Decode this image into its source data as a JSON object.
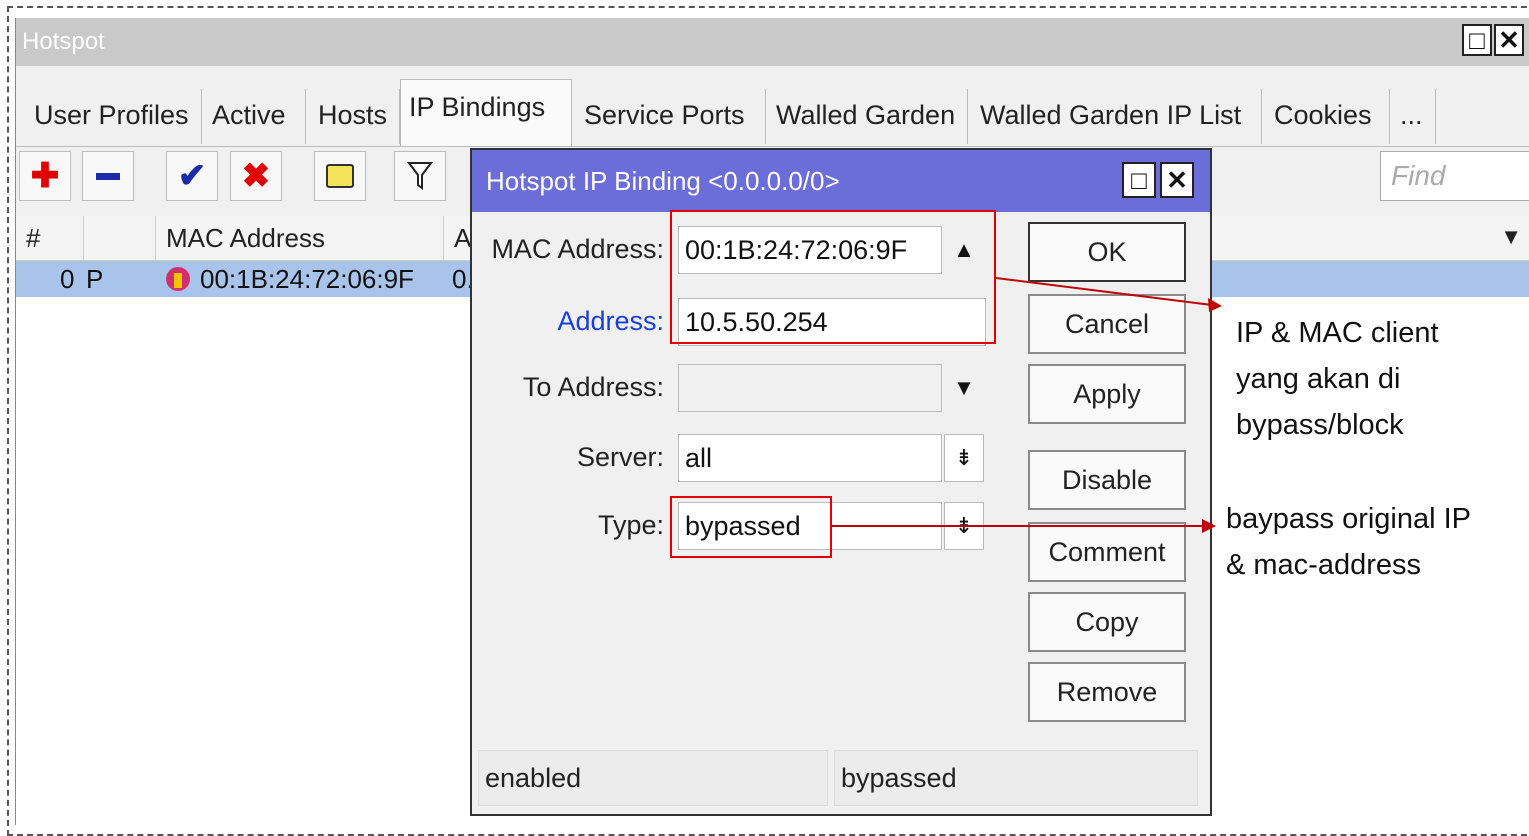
{
  "window": {
    "title": "Hotspot",
    "max_icon": "maximize-icon",
    "close_icon": "close-icon"
  },
  "tabs": [
    {
      "label": "User Profiles"
    },
    {
      "label": "Active"
    },
    {
      "label": "Hosts"
    },
    {
      "label": "IP Bindings",
      "active": true
    },
    {
      "label": "Service Ports"
    },
    {
      "label": "Walled Garden"
    },
    {
      "label": "Walled Garden IP List"
    },
    {
      "label": "Cookies"
    },
    {
      "label": "..."
    }
  ],
  "toolbar": {
    "add_icon": "plus-icon",
    "remove_icon": "minus-icon",
    "enable_icon": "check-icon",
    "disable_icon": "x-icon",
    "comment_icon": "note-icon",
    "filter_icon": "filter-icon",
    "find_placeholder": "Find"
  },
  "table": {
    "headers": [
      "#",
      "",
      "MAC Address",
      "A"
    ],
    "rows": [
      {
        "num": "0",
        "flag": "P",
        "mac": "00:1B:24:72:06:9F",
        "address": "0."
      }
    ]
  },
  "dialog": {
    "title": "Hotspot IP Binding <0.0.0.0/0>",
    "fields": {
      "mac_label": "MAC Address:",
      "mac_value": "00:1B:24:72:06:9F",
      "address_label": "Address:",
      "address_value": "10.5.50.254",
      "to_address_label": "To Address:",
      "to_address_value": "",
      "server_label": "Server:",
      "server_value": "all",
      "type_label": "Type:",
      "type_value": "bypassed"
    },
    "buttons": {
      "ok": "OK",
      "cancel": "Cancel",
      "apply": "Apply",
      "disable": "Disable",
      "comment": "Comment",
      "copy": "Copy",
      "remove": "Remove"
    },
    "status": {
      "left": "enabled",
      "right": "bypassed"
    }
  },
  "annotations": {
    "ipmac": [
      "IP & MAC client",
      "yang akan di",
      "bypass/block"
    ],
    "type": [
      "baypass original IP",
      "& mac-address"
    ]
  },
  "colors": {
    "title_bar": "#6b6ed8",
    "selected_row": "#a9c4ea",
    "annotation": "#e00000",
    "address_label": "#1a3fd6"
  }
}
